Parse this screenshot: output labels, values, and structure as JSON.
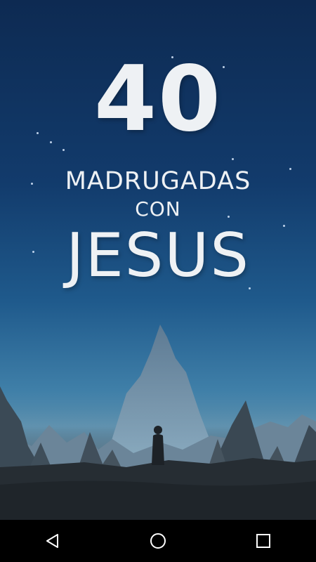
{
  "splash": {
    "number": "40",
    "line1": "MADRUGADAS",
    "line2": "CON",
    "line3": "JESUS"
  },
  "icons": {
    "back": "back-triangle-icon",
    "home": "home-circle-icon",
    "recents": "recents-square-icon"
  },
  "colors": {
    "sky_top": "#0d2a52",
    "sky_mid": "#1f5a8c",
    "horizon": "#5b8fad",
    "ground": "#22282d",
    "title": "#eef1f4",
    "navbar": "#000000"
  }
}
